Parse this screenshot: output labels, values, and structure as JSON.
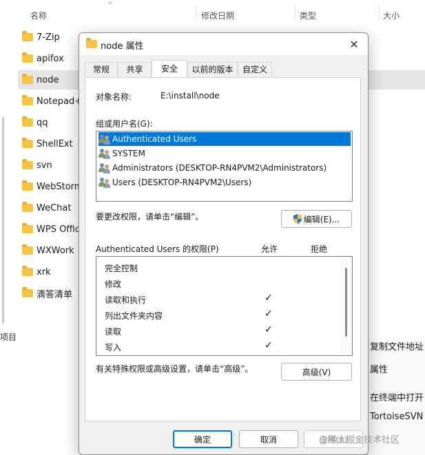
{
  "explorer": {
    "columns": [
      "名称",
      "修改日期",
      "类型",
      "大小"
    ],
    "files": [
      "7-Zip",
      "apifox",
      "node",
      "Notepad+",
      "qq",
      "ShellExt",
      "svn",
      "WebStorm",
      "WeChat",
      "WPS Office",
      "WXWork",
      "xrk",
      "滴答清单"
    ],
    "selected_file": "node",
    "status_text": "项目",
    "context_items": [
      "复制文件地址",
      "属性",
      "在终端中打开",
      "TortoiseSVN"
    ]
  },
  "watermark": "@稀土掘金技术社区",
  "dialog": {
    "title": "node 属性",
    "tabs": [
      "常规",
      "共享",
      "安全",
      "以前的版本",
      "自定义"
    ],
    "active_tab": "安全",
    "object_label": "对象名称:",
    "object_value": "E:\\install\\node",
    "group_label": "组或用户名(G):",
    "users": [
      "Authenticated Users",
      "SYSTEM",
      "Administrators (DESKTOP-RN4PVM2\\Administrators)",
      "Users (DESKTOP-RN4PVM2\\Users)"
    ],
    "change_hint": "要更改权限，请单击“编辑”。",
    "edit_button": "编辑(E)...",
    "perm_label": "Authenticated Users 的权限(P)",
    "allow_label": "允许",
    "deny_label": "拒绝",
    "permissions": [
      {
        "name": "完全控制",
        "allow": ""
      },
      {
        "name": "修改",
        "allow": ""
      },
      {
        "name": "读取和执行",
        "allow": "✓"
      },
      {
        "name": "列出文件夹内容",
        "allow": "✓"
      },
      {
        "name": "读取",
        "allow": "✓"
      },
      {
        "name": "写入",
        "allow": "✓"
      }
    ],
    "advanced_hint": "有关特殊权限或高级设置，请单击“高级”。",
    "advanced_button": "高级(V)",
    "ok_button": "确定",
    "cancel_button": "取消",
    "apply_button": "应用(A)"
  }
}
